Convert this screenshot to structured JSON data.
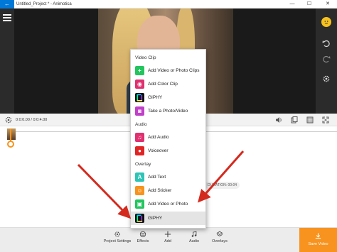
{
  "window": {
    "title": "Untitled_Project * - Animotica",
    "back_glyph": "←",
    "minimize_glyph": "—",
    "maximize_glyph": "☐",
    "close_glyph": "✕"
  },
  "playback": {
    "timecode": "0:0:0.00 / 0:0:4.00"
  },
  "timeline": {
    "duration_label": "DURATION: 00:04"
  },
  "popup": {
    "sections": [
      {
        "title": "Video Clip"
      },
      {
        "title": "Audio"
      },
      {
        "title": "Overlay"
      }
    ],
    "items": [
      {
        "label": "Add Video or Photo Clips",
        "icon": "plus-icon",
        "color": "#22c55e",
        "glyph": "+"
      },
      {
        "label": "Add Color Clip",
        "icon": "palette-icon",
        "color": "#e0306f",
        "glyph": "◉"
      },
      {
        "label": "GIPHY",
        "icon": "giphy-icon",
        "color": "#111111",
        "glyph": ""
      },
      {
        "label": "Take a Photo/Video",
        "icon": "camera-icon",
        "color": "#c040c8",
        "glyph": "◙"
      },
      {
        "label": "Add Audio",
        "icon": "music-note-icon",
        "color": "#e0306f",
        "glyph": "♫"
      },
      {
        "label": "Voiceover",
        "icon": "microphone-icon",
        "color": "#e02424",
        "glyph": "●"
      },
      {
        "label": "Add Text",
        "icon": "text-icon",
        "color": "#2ec4b6",
        "glyph": "A"
      },
      {
        "label": "Add Sticker",
        "icon": "sticker-icon",
        "color": "#f7931e",
        "glyph": "☺"
      },
      {
        "label": "Add Video or Photo",
        "icon": "image-icon",
        "color": "#22c55e",
        "glyph": "▣"
      },
      {
        "label": "GIPHY",
        "icon": "giphy-icon",
        "color": "#111111",
        "glyph": ""
      }
    ]
  },
  "toolbar": {
    "project_settings": "Project Settings",
    "effects": "Effects",
    "add": "Add",
    "audio": "Audio",
    "overlays": "Overlays",
    "save_video": "Save Video"
  },
  "colors": {
    "accent": "#f7931e",
    "titlebar_back": "#0078d7",
    "annotation_arrow": "#d42a1e"
  }
}
